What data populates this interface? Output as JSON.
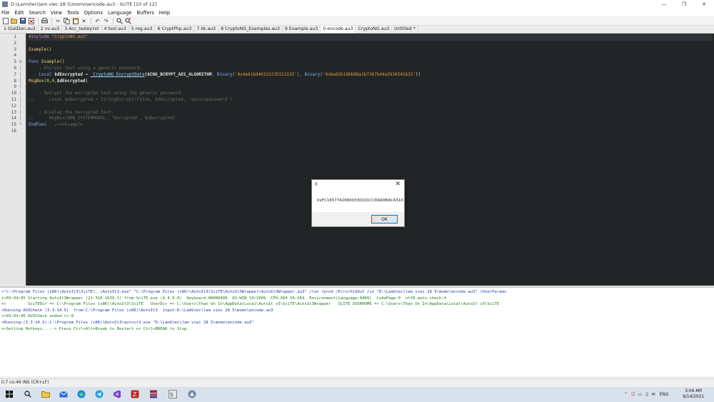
{
  "window": {
    "title": "D:\\LamViec\\lam viec 28 5\\momo\\encode.au3 - SciTE [10 of 12]",
    "min_icon": "minimize-icon",
    "max_icon": "maximize-icon",
    "close_icon": "close-icon"
  },
  "menu": [
    "File",
    "Edit",
    "Search",
    "View",
    "Tools",
    "Options",
    "Language",
    "Buffers",
    "Help"
  ],
  "toolbar": [
    "new-file-icon",
    "open-icon",
    "save-icon",
    "close-file-icon",
    "print-icon",
    "cut-icon",
    "copy-icon",
    "paste-icon",
    "delete-icon",
    "undo-icon",
    "redo-icon",
    "find-icon",
    "replace-icon"
  ],
  "tabs": [
    {
      "label": "1 GiatDon.au3",
      "active": false
    },
    {
      "label": "2 nv.au3",
      "active": false
    },
    {
      "label": "3 Acc_tesley.txt",
      "active": false
    },
    {
      "label": "4 tool.au3",
      "active": false
    },
    {
      "label": "5 reg.au3",
      "active": false
    },
    {
      "label": "6 CryptPhp.au3",
      "active": false
    },
    {
      "label": "7 kk.au3",
      "active": false
    },
    {
      "label": "8 CryptoNG_Examples.au3",
      "active": false
    },
    {
      "label": "9 Example.au3",
      "active": false
    },
    {
      "label": "0 encode.au3",
      "active": true
    },
    {
      "label": "CryptoNG.au3",
      "active": false
    },
    {
      "label": "Untitled *",
      "active": false
    }
  ],
  "editor": {
    "line_numbers": [
      "1",
      "2",
      "3",
      "4",
      "5",
      "6",
      "7",
      "8",
      "9",
      "10",
      "11",
      "12",
      "13",
      "14",
      "15",
      "16"
    ],
    "lines": {
      "l1_dir": "#include",
      "l1_str": " \"CryptoNG.au3\"",
      "l3": "Example()",
      "l5_kw": "Func",
      "l5_name": " Example()",
      "l6": "    ; Encrypt text using a generic password.",
      "l7_kw": "    Local ",
      "l7_var": "$dEncrypted",
      "l7_eq": " = ",
      "l7_fn": "_CryptoNG_EncryptData",
      "l7_args1": "($CNG_BCRYPT_AES_ALGORITHM",
      "l7_bin1": ", Binary(",
      "l7_s1": "'0x4e616d40323235323235'",
      "l7_bin2": "), Binary(",
      "l7_s2": "'0xba82b18bb98a1b7367b44a3930545633'",
      "l7_end": "))",
      "l8_fn": "MsgBox",
      "l8_args": "(0,0,",
      "l8_var": "$dEncrypted",
      "l8_end": ")",
      "l10": "    ; Decrypt the encrypted text using the generic password.",
      "l11": ";~      Local $sDecrypted = StringEncrypt(False, $dEncrypted, 'securepassword')",
      "l13": "    ; Display the decrypted text.",
      "l14": ";~      MsgBox($MB_SYSTEMMODAL, 'Decrypted', $sDecrypted)",
      "l15_kw": "EndFunc",
      "l15_com": "   ;==>Example"
    }
  },
  "dialog": {
    "title": "0",
    "message": "0xFC16577426800330101CC69A0BACA310",
    "ok_label": "OK"
  },
  "output": [
    ">\"C:\\Program Files (x86)\\AutoIt3\\SciTE\\..\\AutoIt3.exe\" \"C:\\Program Files (x86)\\AutoIt3\\SciTE\\AutoIt3Wrapper\\AutoIt3Wrapper.au3\" /run /prod /ErrorStdOut /in \"D:\\LamViec\\lam viec 28 5\\momo\\encode.au3\" /UserParams",
    "+>03:04:05 Starting AutoIt3Wrapper (21.316.1639.1) from:SciTE.exe (4.4.6.0)  Keyboard:00000409  OS:WIN_10/2009  CPU:X64 OS:X64  Environment(Language:0409)  CodePage:0  utf8.auto.check:4",
    "+>         SciTEDir => C:\\Program Files (x86)\\AutoIt3\\SciTE   UserDir => C:\\Users\\Thao Un In\\AppData\\Local\\AutoIt v3\\SciTE\\AutoIt3Wrapper   SCITE_USERHOME => C:\\Users\\Thao Un In\\AppData\\Local\\AutoIt v3\\SciTE",
    ">Running AU3Check (3.3.14.5)  from:C:\\Program Files (x86)\\AutoIt3  input:D:\\LamViec\\lam viec 28 5\\momo\\encode.au3",
    "+>03:04:06 AU3Check ended.rc:0",
    ">Running:(3.3.14.5):C:\\Program Files (x86)\\AutoIt3\\autoit3.exe \"D:\\LamViec\\lam viec 28 5\\momo\\encode.au3\"",
    "+>Setting Hotkeys...--> Press Ctrl+Alt+Break to Restart or Ctrl+BREAK to Stop."
  ],
  "status": "li:7 co:46 INS (CR+LF)",
  "taskbar": {
    "apps": [
      "windows-start-icon",
      "search-icon",
      "file-explorer-icon",
      "mail-icon",
      "edge-icon",
      "telegram-icon",
      "visual-studio-icon",
      "filezilla-icon",
      "winrar-icon",
      "scite-icon",
      "obs-icon",
      "autoit-tool-icon",
      "autoit-icon"
    ],
    "language": "ENG",
    "time": "3:04 AM",
    "date": "8/14/2021",
    "tray_icons": [
      "chevron-up-icon",
      "antivirus-icon",
      "network-icon",
      "volume-icon",
      "notification-icon"
    ]
  },
  "colors": {
    "editor_bg": "#222526",
    "output_blue": "#1f3fa0",
    "output_green": "#1d7a1d",
    "dialog_ok_border": "#0078d7"
  }
}
